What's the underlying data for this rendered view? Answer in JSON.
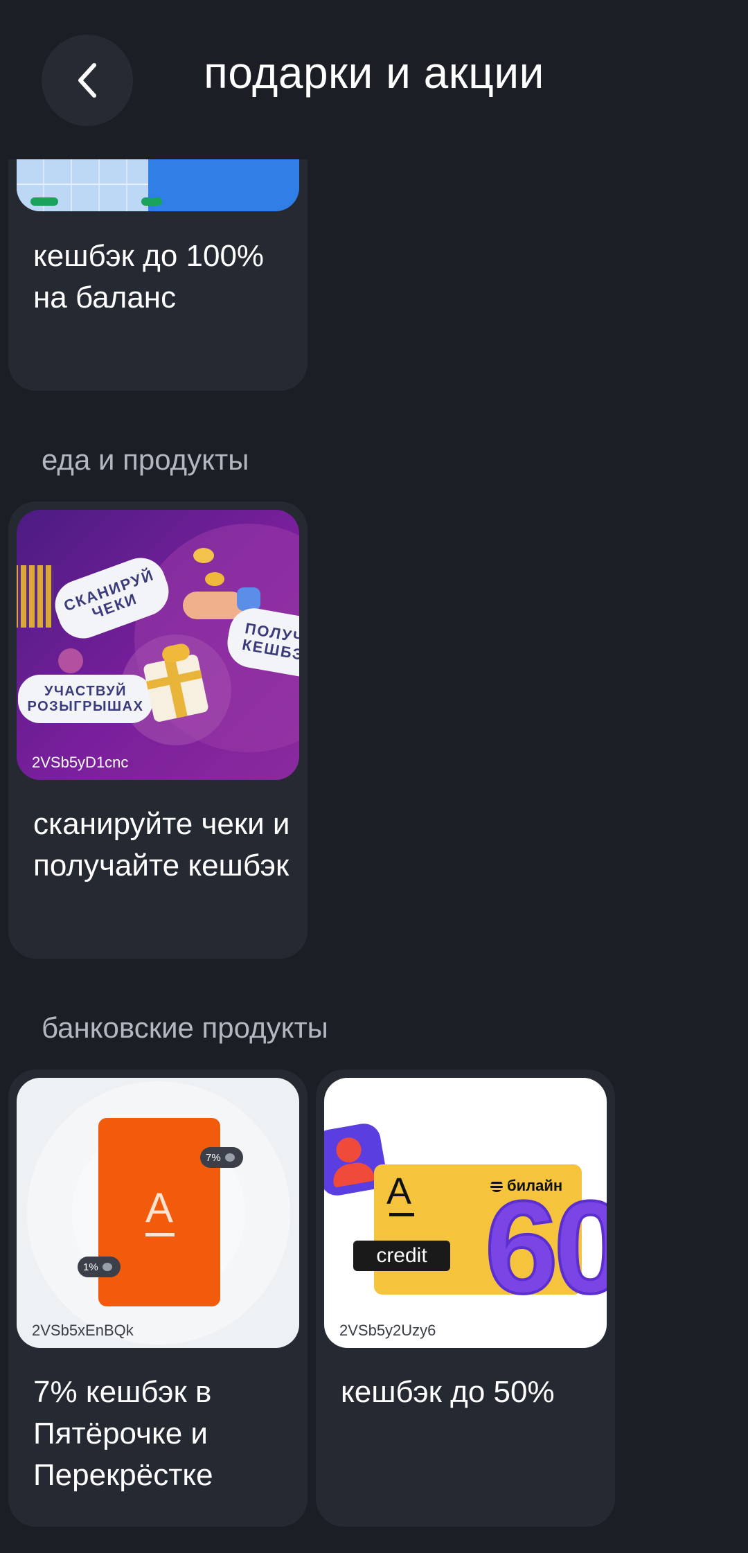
{
  "header": {
    "title": "подарки и акции",
    "back_icon": "chevron-left-icon"
  },
  "cards": {
    "balance": {
      "title": "кешбэк до 100% на баланс"
    },
    "scan": {
      "title": "сканируйте чеки и получайте кешбэк",
      "erid": "2VSb5yD1cnc",
      "bubble_scan": "СКАНИРУЙ\nЧЕКИ",
      "bubble_get": "ПОЛУЧ\nКЕШБЭ",
      "bubble_join": "УЧАСТВУЙ\nРОЗЫГРЫШАХ"
    },
    "alfa_card": {
      "title": "7% кешбэк в Пятёрочке и Перекрёстке",
      "erid": "2VSb5xEnBQk",
      "badge_7": "7%",
      "badge_1": "1%",
      "logo": "А"
    },
    "alfa_credit": {
      "title": "кешбэк до 50%",
      "erid": "2VSb5y2Uzy6",
      "credit_label": "credit",
      "beeline_label": "билайн",
      "big_number": "60",
      "logo": "А"
    }
  },
  "sections": {
    "food": "еда и продукты",
    "bank": "банковские продукты"
  },
  "colors": {
    "background": "#1b1e25",
    "card": "#252932",
    "alfa_orange": "#f25a0c",
    "beeline_yellow": "#f5c33c",
    "promo_purple": "#6a1f9a"
  }
}
